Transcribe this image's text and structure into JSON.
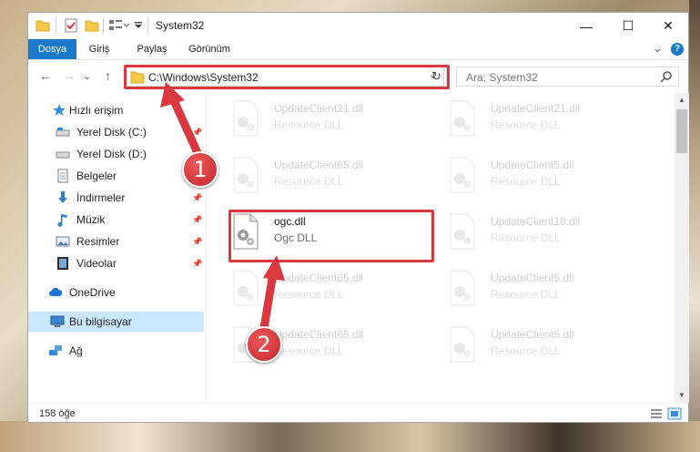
{
  "window": {
    "title": "System32",
    "minimize_glyph": "—",
    "maximize_glyph": "☐",
    "close_glyph": "✕"
  },
  "ribbon": {
    "tabs": [
      {
        "label": "Dosya",
        "active": true
      },
      {
        "label": "Giriş",
        "active": false
      },
      {
        "label": "Paylaş",
        "active": false
      },
      {
        "label": "Görünüm",
        "active": false
      }
    ],
    "expand_glyph": "⌄",
    "help_glyph": "?"
  },
  "address": {
    "back_glyph": "←",
    "forward_glyph": "→",
    "recent_glyph": "⌄",
    "up_glyph": "↑",
    "path": "C:\\Windows\\System32",
    "dropdown_glyph": "⌄",
    "refresh_glyph": "↻"
  },
  "search": {
    "placeholder": "Ara: System32",
    "icon": "search-icon"
  },
  "sidebar": {
    "items": [
      {
        "label": "Hızlı erişim",
        "icon": "star-icon",
        "pinned": false
      },
      {
        "label": "Yerel Disk (C:)",
        "icon": "drive-icon",
        "pinned": true
      },
      {
        "label": "Yerel Disk (D:)",
        "icon": "drive-icon",
        "pinned": true
      },
      {
        "label": "Belgeler",
        "icon": "documents-icon",
        "pinned": true
      },
      {
        "label": "İndirmeler",
        "icon": "downloads-icon",
        "pinned": true
      },
      {
        "label": "Müzik",
        "icon": "music-icon",
        "pinned": true
      },
      {
        "label": "Resimler",
        "icon": "pictures-icon",
        "pinned": true
      },
      {
        "label": "Videolar",
        "icon": "videos-icon",
        "pinned": true
      },
      {
        "label": "OneDrive",
        "icon": "cloud-icon",
        "pinned": false
      },
      {
        "label": "Bu bilgisayar",
        "icon": "computer-icon",
        "pinned": false,
        "selected": true
      },
      {
        "label": "Ağ",
        "icon": "network-icon",
        "pinned": false
      }
    ],
    "pin_glyph": "📌"
  },
  "files": [
    {
      "name": "UpdateClient21.dll",
      "type": "Resource DLL",
      "faded": true
    },
    {
      "name": "UpdateClient21.dll",
      "type": "Resource DLL",
      "faded": true
    },
    {
      "name": "UpdateClient65.dll",
      "type": "Resource DLL",
      "faded": true
    },
    {
      "name": "UpdateClient5.dll",
      "type": "Resource DLL",
      "faded": true
    },
    {
      "name": "ogc.dll",
      "type": "Ogc DLL",
      "faded": false
    },
    {
      "name": "UpdateClient19.dll",
      "type": "Resource DLL",
      "faded": true
    },
    {
      "name": "UpdateClient65.dll",
      "type": "Resource DLL",
      "faded": true
    },
    {
      "name": "UpdateClient5.dll",
      "type": "Resource DLL",
      "faded": true
    },
    {
      "name": "UpdateClient65.dll",
      "type": "Resource DLL",
      "faded": true
    },
    {
      "name": "UpdateClient5.dll",
      "type": "Resource DLL",
      "faded": true
    }
  ],
  "status": {
    "item_count": "158 öğe"
  },
  "callouts": [
    "1",
    "2"
  ],
  "colors": {
    "accent": "#1979ca",
    "highlight": "#d9383f",
    "selected": "#cce8ff"
  }
}
